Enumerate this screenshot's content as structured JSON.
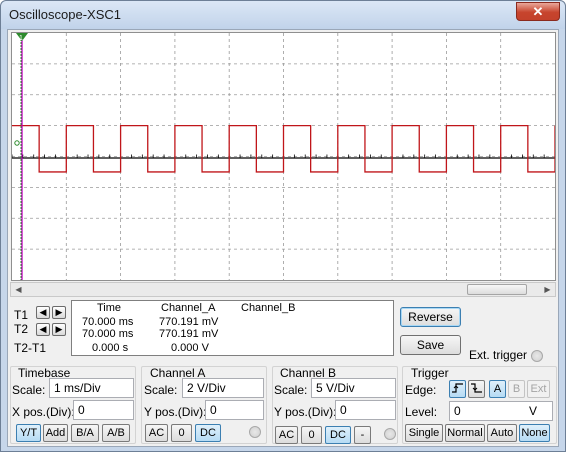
{
  "window": {
    "title": "Oscilloscope-XSC1",
    "close_label": "✕"
  },
  "screen": {
    "colors": {
      "background": "#ffffff",
      "grid": "#9a9a9a",
      "channel_a": "#c0161a",
      "channel_b": "#000000",
      "cursor_t1": "#c000c0",
      "cursor_t2": "#2c8a2c"
    },
    "channel_a_wave": {
      "type": "square",
      "cycles": 10,
      "high_div": 1,
      "low_div": -0.5
    },
    "cursor_marker_label": "1"
  },
  "cursors": {
    "t1_label": "T1",
    "t2_label": "T2",
    "diff_label": "T2-T1"
  },
  "readout": {
    "headers": {
      "time": "Time",
      "channel_a": "Channel_A",
      "channel_b": "Channel_B"
    },
    "rows": [
      {
        "time": "70.000 ms",
        "channel_a": "770.191 mV",
        "channel_b": ""
      },
      {
        "time": "70.000 ms",
        "channel_a": "770.191 mV",
        "channel_b": ""
      },
      {
        "time": "0.000 s",
        "channel_a": "0.000 V",
        "channel_b": ""
      }
    ]
  },
  "buttons": {
    "reverse": "Reverse",
    "save": "Save",
    "ext_trigger": "Ext. trigger"
  },
  "timebase": {
    "title": "Timebase",
    "scale_label": "Scale:",
    "scale_value": "1 ms/Div",
    "xpos_label": "X pos.(Div):",
    "xpos_value": "0",
    "modes": [
      "Y/T",
      "Add",
      "B/A",
      "A/B"
    ],
    "selected_mode": "Y/T"
  },
  "channel_a": {
    "title": "Channel A",
    "scale_label": "Scale:",
    "scale_value": "2  V/Div",
    "ypos_label": "Y pos.(Div):",
    "ypos_value": "0",
    "coupling": [
      "AC",
      "0",
      "DC"
    ],
    "selected_coupling": "DC"
  },
  "channel_b": {
    "title": "Channel B",
    "scale_label": "Scale:",
    "scale_value": "5  V/Div",
    "ypos_label": "Y pos.(Div):",
    "ypos_value": "0",
    "coupling": [
      "AC",
      "0",
      "DC",
      "-"
    ],
    "selected_coupling": "DC"
  },
  "trigger": {
    "title": "Trigger",
    "edge_label": "Edge:",
    "edge_sources": [
      "A",
      "B",
      "Ext"
    ],
    "selected_source": "A",
    "level_label": "Level:",
    "level_value": "0",
    "level_unit": "V",
    "modes": [
      "Single",
      "Normal",
      "Auto",
      "None"
    ],
    "selected_mode": "None"
  }
}
